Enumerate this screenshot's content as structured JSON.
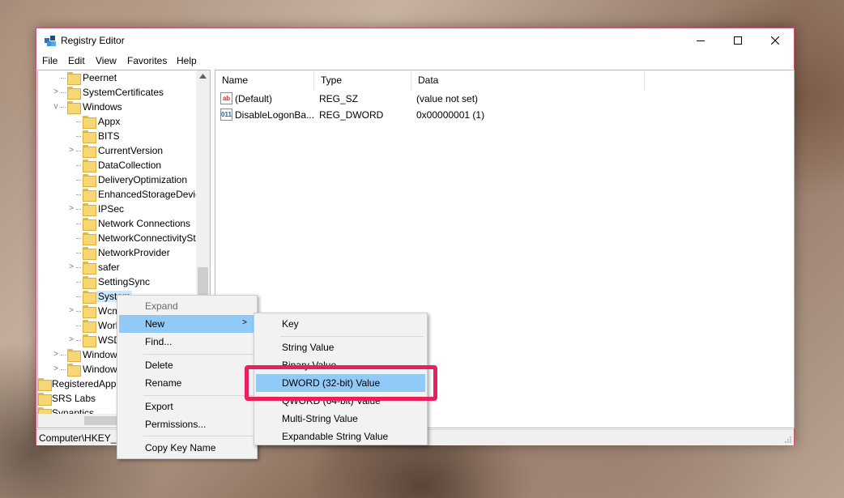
{
  "window": {
    "title": "Registry Editor",
    "accent_border": "#cc4e6e"
  },
  "menubar": [
    "File",
    "Edit",
    "View",
    "Favorites",
    "Help"
  ],
  "tree": {
    "items": [
      {
        "label": "Peernet",
        "expander": ""
      },
      {
        "label": "SystemCertificates",
        "expander": ">"
      },
      {
        "label": "Windows",
        "expander": "v"
      },
      {
        "label": "Appx",
        "expander": ""
      },
      {
        "label": "BITS",
        "expander": ""
      },
      {
        "label": "CurrentVersion",
        "expander": ">"
      },
      {
        "label": "DataCollection",
        "expander": ""
      },
      {
        "label": "DeliveryOptimization",
        "expander": ""
      },
      {
        "label": "EnhancedStorageDevice",
        "expander": ""
      },
      {
        "label": "IPSec",
        "expander": ">"
      },
      {
        "label": "Network Connections",
        "expander": ""
      },
      {
        "label": "NetworkConnectivitySt",
        "expander": ""
      },
      {
        "label": "NetworkProvider",
        "expander": ""
      },
      {
        "label": "safer",
        "expander": ">"
      },
      {
        "label": "SettingSync",
        "expander": ""
      },
      {
        "label": "System",
        "expander": "",
        "selected": true
      },
      {
        "label": "Wcm",
        "expander": ">"
      },
      {
        "label": "Worl",
        "expander": ""
      },
      {
        "label": "WSD",
        "expander": ">"
      },
      {
        "label": "Window",
        "expander": ">"
      },
      {
        "label": "Window",
        "expander": ">"
      },
      {
        "label": "RegisteredAppl",
        "expander": ""
      },
      {
        "label": "SRS Labs",
        "expander": ""
      },
      {
        "label": "Synaptics",
        "expander": ""
      }
    ]
  },
  "list": {
    "columns": [
      "Name",
      "Type",
      "Data"
    ],
    "rows": [
      {
        "icon": "ab",
        "name": "(Default)",
        "type": "REG_SZ",
        "data": "(value not set)"
      },
      {
        "icon": "011",
        "name": "DisableLogonBa...",
        "type": "REG_DWORD",
        "data": "0x00000001 (1)"
      }
    ]
  },
  "status": {
    "path": "Computer\\HKEY_L"
  },
  "context_menu": {
    "expand": "Expand",
    "new": "New",
    "find": "Find...",
    "delete": "Delete",
    "rename": "Rename",
    "export": "Export",
    "permissions": "Permissions...",
    "copy_key_name": "Copy Key Name",
    "submenu_arrow": ">"
  },
  "submenu": {
    "key": "Key",
    "string_value": "String Value",
    "binary_value": "Binary Value",
    "dword_value": "DWORD (32-bit) Value",
    "qword_value": "QWORD (64-bit) Value",
    "multi_string_value": "Multi-String Value",
    "expandable_string_value": "Expandable String Value"
  },
  "colors": {
    "highlight_box": "#e8215d",
    "menu_hover": "#91c9f7",
    "selection": "#cce8ff"
  }
}
